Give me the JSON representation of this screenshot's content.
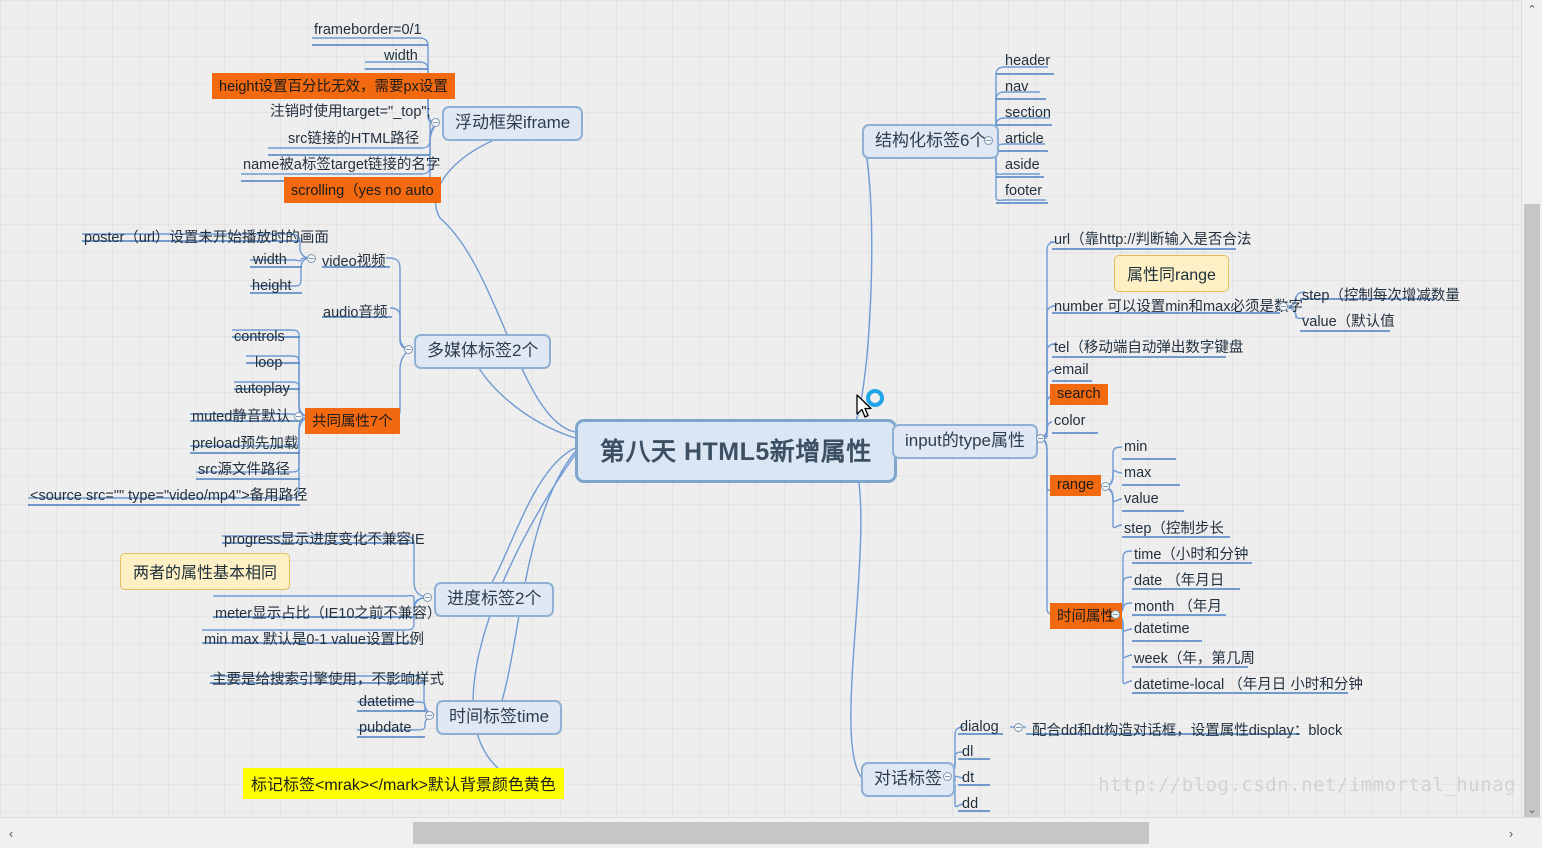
{
  "watermark": "http://blog.csdn.net/immortal_hunag",
  "root": {
    "label": "第八天 HTML5新增属性"
  },
  "colors": {
    "accent_orange": "#f2690f",
    "accent_yellow": "#ffff00",
    "callout_bg": "#fdf0c4",
    "node_fill": "#dfe8f4",
    "node_border": "#8fb0d2",
    "wire": "#6f9ad3"
  },
  "branches": {
    "iframe": {
      "label": "浮动框架iframe",
      "children": [
        {
          "label": "frameborder=0/1",
          "style": "plain"
        },
        {
          "label": "width",
          "style": "plain"
        },
        {
          "label": "height设置百分比无效，需要px设置",
          "style": "orange"
        },
        {
          "label": "注销时使用target=\"_top\";",
          "style": "plain"
        },
        {
          "label": "src链接的HTML路径",
          "style": "plain"
        },
        {
          "label": "name被a标签target链接的名字",
          "style": "plain"
        },
        {
          "label": "scrolling（yes no auto",
          "style": "orange"
        }
      ]
    },
    "structural": {
      "label": "结构化标签6个",
      "children": [
        {
          "label": "header",
          "style": "plain"
        },
        {
          "label": "nav",
          "style": "plain"
        },
        {
          "label": "section",
          "style": "plain"
        },
        {
          "label": "article",
          "style": "plain"
        },
        {
          "label": "aside",
          "style": "plain"
        },
        {
          "label": "footer",
          "style": "plain"
        }
      ]
    },
    "multimedia": {
      "label": "多媒体标签2个",
      "children": [
        {
          "label": "video视频",
          "style": "plain",
          "children": [
            {
              "label": "poster（url）设置未开始播放时的画面",
              "style": "plain"
            },
            {
              "label": "width",
              "style": "plain"
            },
            {
              "label": "height",
              "style": "plain"
            }
          ]
        },
        {
          "label": "audio音频",
          "style": "plain"
        },
        {
          "label": "共同属性7个",
          "style": "orange",
          "children": [
            {
              "label": "controls",
              "style": "plain"
            },
            {
              "label": "loop",
              "style": "plain"
            },
            {
              "label": "autoplay",
              "style": "plain"
            },
            {
              "label": "muted静音默认",
              "style": "plain"
            },
            {
              "label": "preload预先加载",
              "style": "plain"
            },
            {
              "label": "src源文件路径",
              "style": "plain"
            },
            {
              "label": "<source src=\"\" type=\"video/mp4\">备用路径",
              "style": "plain"
            }
          ]
        }
      ]
    },
    "progress": {
      "label": "进度标签2个",
      "callout": "两者的属性基本相同",
      "children": [
        {
          "label": "progress显示进度变化不兼容IE",
          "style": "plain"
        },
        {
          "label": "meter显示占比（IE10之前不兼容）",
          "style": "plain"
        },
        {
          "label": "min max 默认是0-1 value设置比例",
          "style": "plain"
        }
      ]
    },
    "time": {
      "label": "时间标签time",
      "children": [
        {
          "label": "主要是给搜索引擎使用，不影响样式",
          "style": "plain"
        },
        {
          "label": "datetime",
          "style": "plain"
        },
        {
          "label": "pubdate",
          "style": "plain"
        }
      ]
    },
    "mark": {
      "label": "标记标签<mrak></mark>默认背景颜色黄色",
      "style": "yellow"
    },
    "input_type": {
      "label": "input的type属性",
      "callout": "属性同range",
      "children": [
        {
          "label": "url（靠http://判断输入是否合法",
          "style": "plain"
        },
        {
          "label": "number 可以设置min和max必须是数字",
          "style": "plain",
          "children": [
            {
              "label": "step（控制每次增减数量",
              "style": "plain"
            },
            {
              "label": "value（默认值",
              "style": "plain"
            }
          ]
        },
        {
          "label": "tel（移动端自动弹出数字键盘",
          "style": "plain"
        },
        {
          "label": "email",
          "style": "plain"
        },
        {
          "label": "search",
          "style": "orange"
        },
        {
          "label": "color",
          "style": "plain"
        },
        {
          "label": "range",
          "style": "orange",
          "children": [
            {
              "label": "min",
              "style": "plain"
            },
            {
              "label": "max",
              "style": "plain"
            },
            {
              "label": "value",
              "style": "plain"
            },
            {
              "label": "step（控制步长",
              "style": "plain"
            }
          ]
        },
        {
          "label": "时间属性",
          "style": "orange",
          "children": [
            {
              "label": "time（小时和分钟",
              "style": "plain"
            },
            {
              "label": "date （年月日",
              "style": "plain"
            },
            {
              "label": "month （年月",
              "style": "plain"
            },
            {
              "label": "datetime",
              "style": "plain"
            },
            {
              "label": "week（年，第几周",
              "style": "plain"
            },
            {
              "label": "datetime-local （年月日 小时和分钟",
              "style": "plain"
            }
          ]
        }
      ]
    },
    "dialog": {
      "label": "对话标签",
      "children": [
        {
          "label": "dialog",
          "style": "plain",
          "children": [
            {
              "label": "配合dd和dt构造对话框，设置属性display：block",
              "style": "plain"
            }
          ]
        },
        {
          "label": "dl",
          "style": "plain"
        },
        {
          "label": "dt",
          "style": "plain"
        },
        {
          "label": "dd",
          "style": "plain"
        }
      ]
    }
  },
  "scrollbars": {
    "up_arrow": "⌃",
    "down_arrow": "⌄",
    "left_arrow": "‹",
    "right_arrow": "›"
  }
}
